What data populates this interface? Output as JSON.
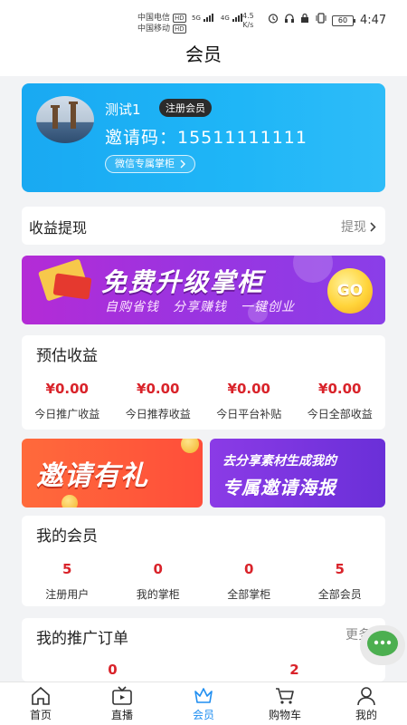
{
  "status_bar": {
    "carrier1": "中国电信",
    "carrier2": "中国移动",
    "hd": "HD",
    "net1": "5G",
    "net2": "4G",
    "speed_value": "4.5",
    "speed_unit": "K/s",
    "battery": "60",
    "time": "4:47"
  },
  "header": {
    "title": "会员"
  },
  "member_card": {
    "username": "测试1",
    "badge": "注册会员",
    "invite_code": "邀请码：15511111111",
    "wechat_button": "微信专属掌柜"
  },
  "withdraw": {
    "title": "收益提现",
    "link": "提现"
  },
  "banner": {
    "main": "免费升级掌柜",
    "sub": "自购省钱　分享赚钱　一键创业",
    "go": "GO"
  },
  "earnings": {
    "title": "预估收益",
    "items": [
      {
        "value": "¥0.00",
        "label": "今日推广收益"
      },
      {
        "value": "¥0.00",
        "label": "今日推荐收益"
      },
      {
        "value": "¥0.00",
        "label": "今日平台补贴"
      },
      {
        "value": "¥0.00",
        "label": "今日全部收益"
      }
    ]
  },
  "promo": {
    "left": "邀请有礼",
    "right_line1": "去分享素材生成我的",
    "right_line2": "专属邀请海报"
  },
  "members": {
    "title": "我的会员",
    "items": [
      {
        "value": "5",
        "label": "注册用户"
      },
      {
        "value": "0",
        "label": "我的掌柜"
      },
      {
        "value": "0",
        "label": "全部掌柜"
      },
      {
        "value": "5",
        "label": "全部会员"
      }
    ]
  },
  "orders": {
    "title": "我的推广订单",
    "link": "更多",
    "values": [
      "0",
      "2"
    ]
  },
  "tabbar": {
    "tabs": [
      {
        "label": "首页",
        "icon": "home-icon"
      },
      {
        "label": "直播",
        "icon": "tv-icon"
      },
      {
        "label": "会员",
        "icon": "crown-icon"
      },
      {
        "label": "购物车",
        "icon": "cart-icon"
      },
      {
        "label": "我的",
        "icon": "user-icon"
      }
    ],
    "active": "会员",
    "active_color": "#1f8ef1"
  },
  "colors": {
    "card_blue": "#1fb6f7",
    "money_red": "#d9232a",
    "banner_purple": "#9b34e0",
    "promo_orange": "#ff5a3a"
  }
}
